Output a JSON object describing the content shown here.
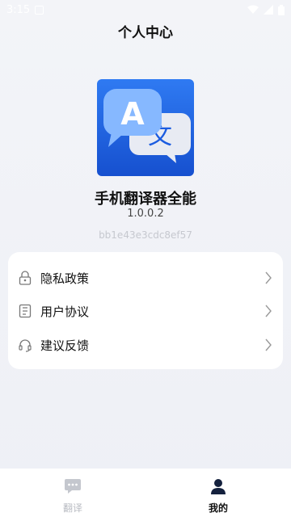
{
  "status_bar": {
    "time": "3:15"
  },
  "header": {
    "title": "个人中心"
  },
  "app": {
    "name": "手机翻译器全能",
    "version": "1.0.0.2",
    "device_id": "bb1e43e3cdc8ef57",
    "icon": "translate-app-icon",
    "icon_letters": {
      "a": "A",
      "x": "文"
    }
  },
  "menu": {
    "items": [
      {
        "label": "隐私政策",
        "icon": "lock-icon"
      },
      {
        "label": "用户协议",
        "icon": "document-icon"
      },
      {
        "label": "建议反馈",
        "icon": "headset-icon"
      }
    ]
  },
  "tabbar": {
    "tabs": [
      {
        "label": "翻译",
        "icon": "chat-icon",
        "active": false
      },
      {
        "label": "我的",
        "icon": "person-icon",
        "active": true
      }
    ]
  },
  "colors": {
    "accent": "#1677ff",
    "icon_blue": "#1b5ce0"
  }
}
